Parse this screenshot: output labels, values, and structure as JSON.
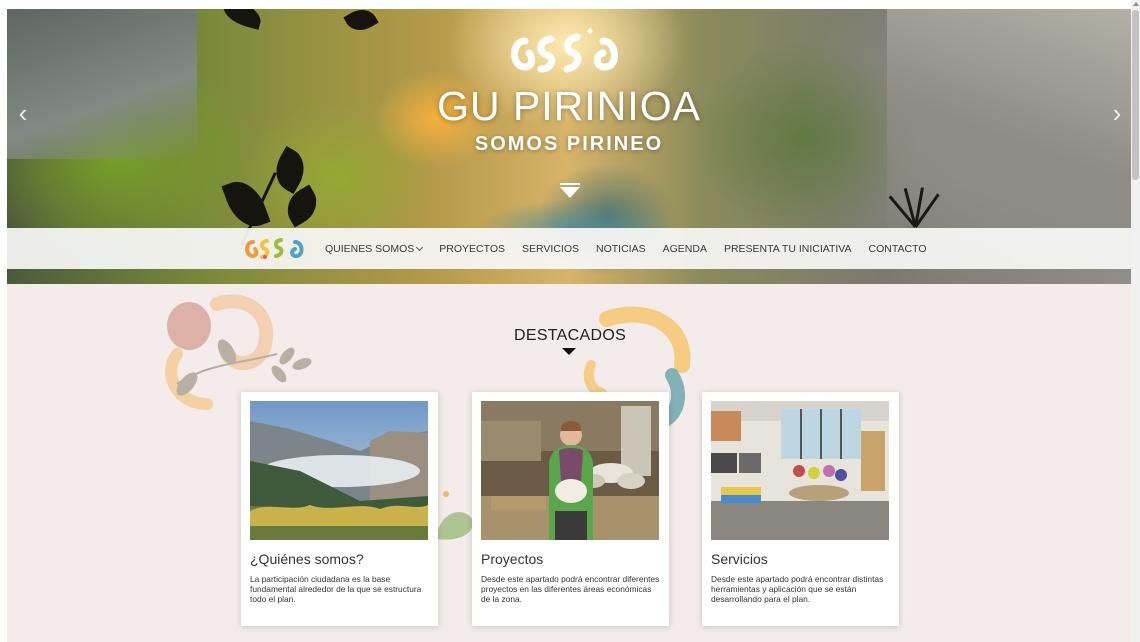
{
  "hero": {
    "title": "GU PIRINIOA",
    "subtitle": "SOMOS PIRINEO",
    "prev_arrow": "‹",
    "next_arrow": "›"
  },
  "nav": {
    "items": [
      {
        "label": "QUIENES SOMOS"
      },
      {
        "label": "PROYECTOS"
      },
      {
        "label": "SERVICIOS"
      },
      {
        "label": "NOTICIAS"
      },
      {
        "label": "AGENDA"
      },
      {
        "label": "PRESENTA TU INICIATIVA"
      },
      {
        "label": "CONTACTO"
      }
    ]
  },
  "section": {
    "title": "DESTACADOS"
  },
  "cards": [
    {
      "title": "¿Quiénes somos?",
      "text": "La participación ciudadana es la base fundamental alrededor de la que se estructura todo el plan."
    },
    {
      "title": "Proyectos",
      "text": "Desde este apartado podrá encontrar diferentes proyectos en las diferentes áreas económicas de la zona."
    },
    {
      "title": "Servicios",
      "text": "Desde este apartado podrá encontrar distintas herramientas y aplicación que se están desarrollando para el plan."
    }
  ],
  "colors": {
    "page_bg": "#f3ecea",
    "nav_bg": "#f8f8f6",
    "logo_orange": "#f29a3a",
    "logo_yellow": "#f4c33b",
    "logo_green": "#9ebd3e",
    "logo_blue": "#4fa3c4",
    "logo_pink": "#e0567a"
  }
}
